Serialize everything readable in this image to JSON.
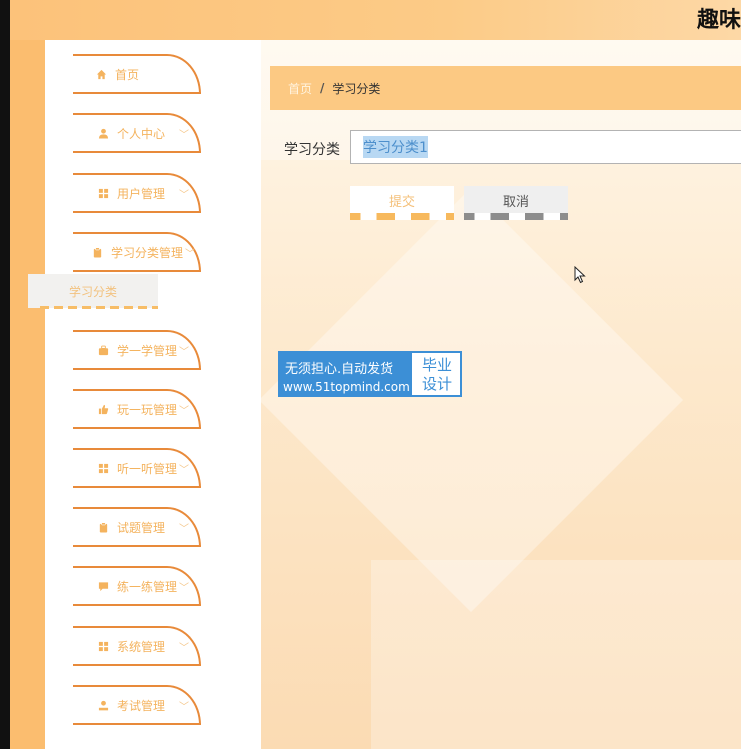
{
  "app_title": "趣味",
  "sidebar": {
    "items": [
      {
        "label": "首页",
        "icon": "home-icon"
      },
      {
        "label": "个人中心",
        "icon": "user-icon"
      },
      {
        "label": "用户管理",
        "icon": "grid-icon"
      },
      {
        "label": "学习分类管理",
        "icon": "clipboard-icon"
      },
      {
        "label": "学一学管理",
        "icon": "briefcase-icon"
      },
      {
        "label": "玩一玩管理",
        "icon": "thumbs-up-icon"
      },
      {
        "label": "听一听管理",
        "icon": "grid-icon"
      },
      {
        "label": "试题管理",
        "icon": "clipboard-icon"
      },
      {
        "label": "练一练管理",
        "icon": "chat-icon"
      },
      {
        "label": "系统管理",
        "icon": "grid-icon"
      },
      {
        "label": "考试管理",
        "icon": "person-icon"
      }
    ],
    "submenu_item": "学习分类"
  },
  "breadcrumb": {
    "home": "首页",
    "separator": "/",
    "current": "学习分类"
  },
  "form": {
    "field_label": "学习分类",
    "field_value": "学习分类1",
    "submit_label": "提交",
    "cancel_label": "取消"
  },
  "watermark": {
    "line1": "无须担心.自动发货",
    "line2": "www.51topmind.com",
    "right_line1": "毕业",
    "right_line2": "设计"
  },
  "colors": {
    "accent": "#fcc983",
    "border": "#e88a3a",
    "menu_text": "#f4b35e",
    "watermark_blue": "#3c8fd6"
  }
}
